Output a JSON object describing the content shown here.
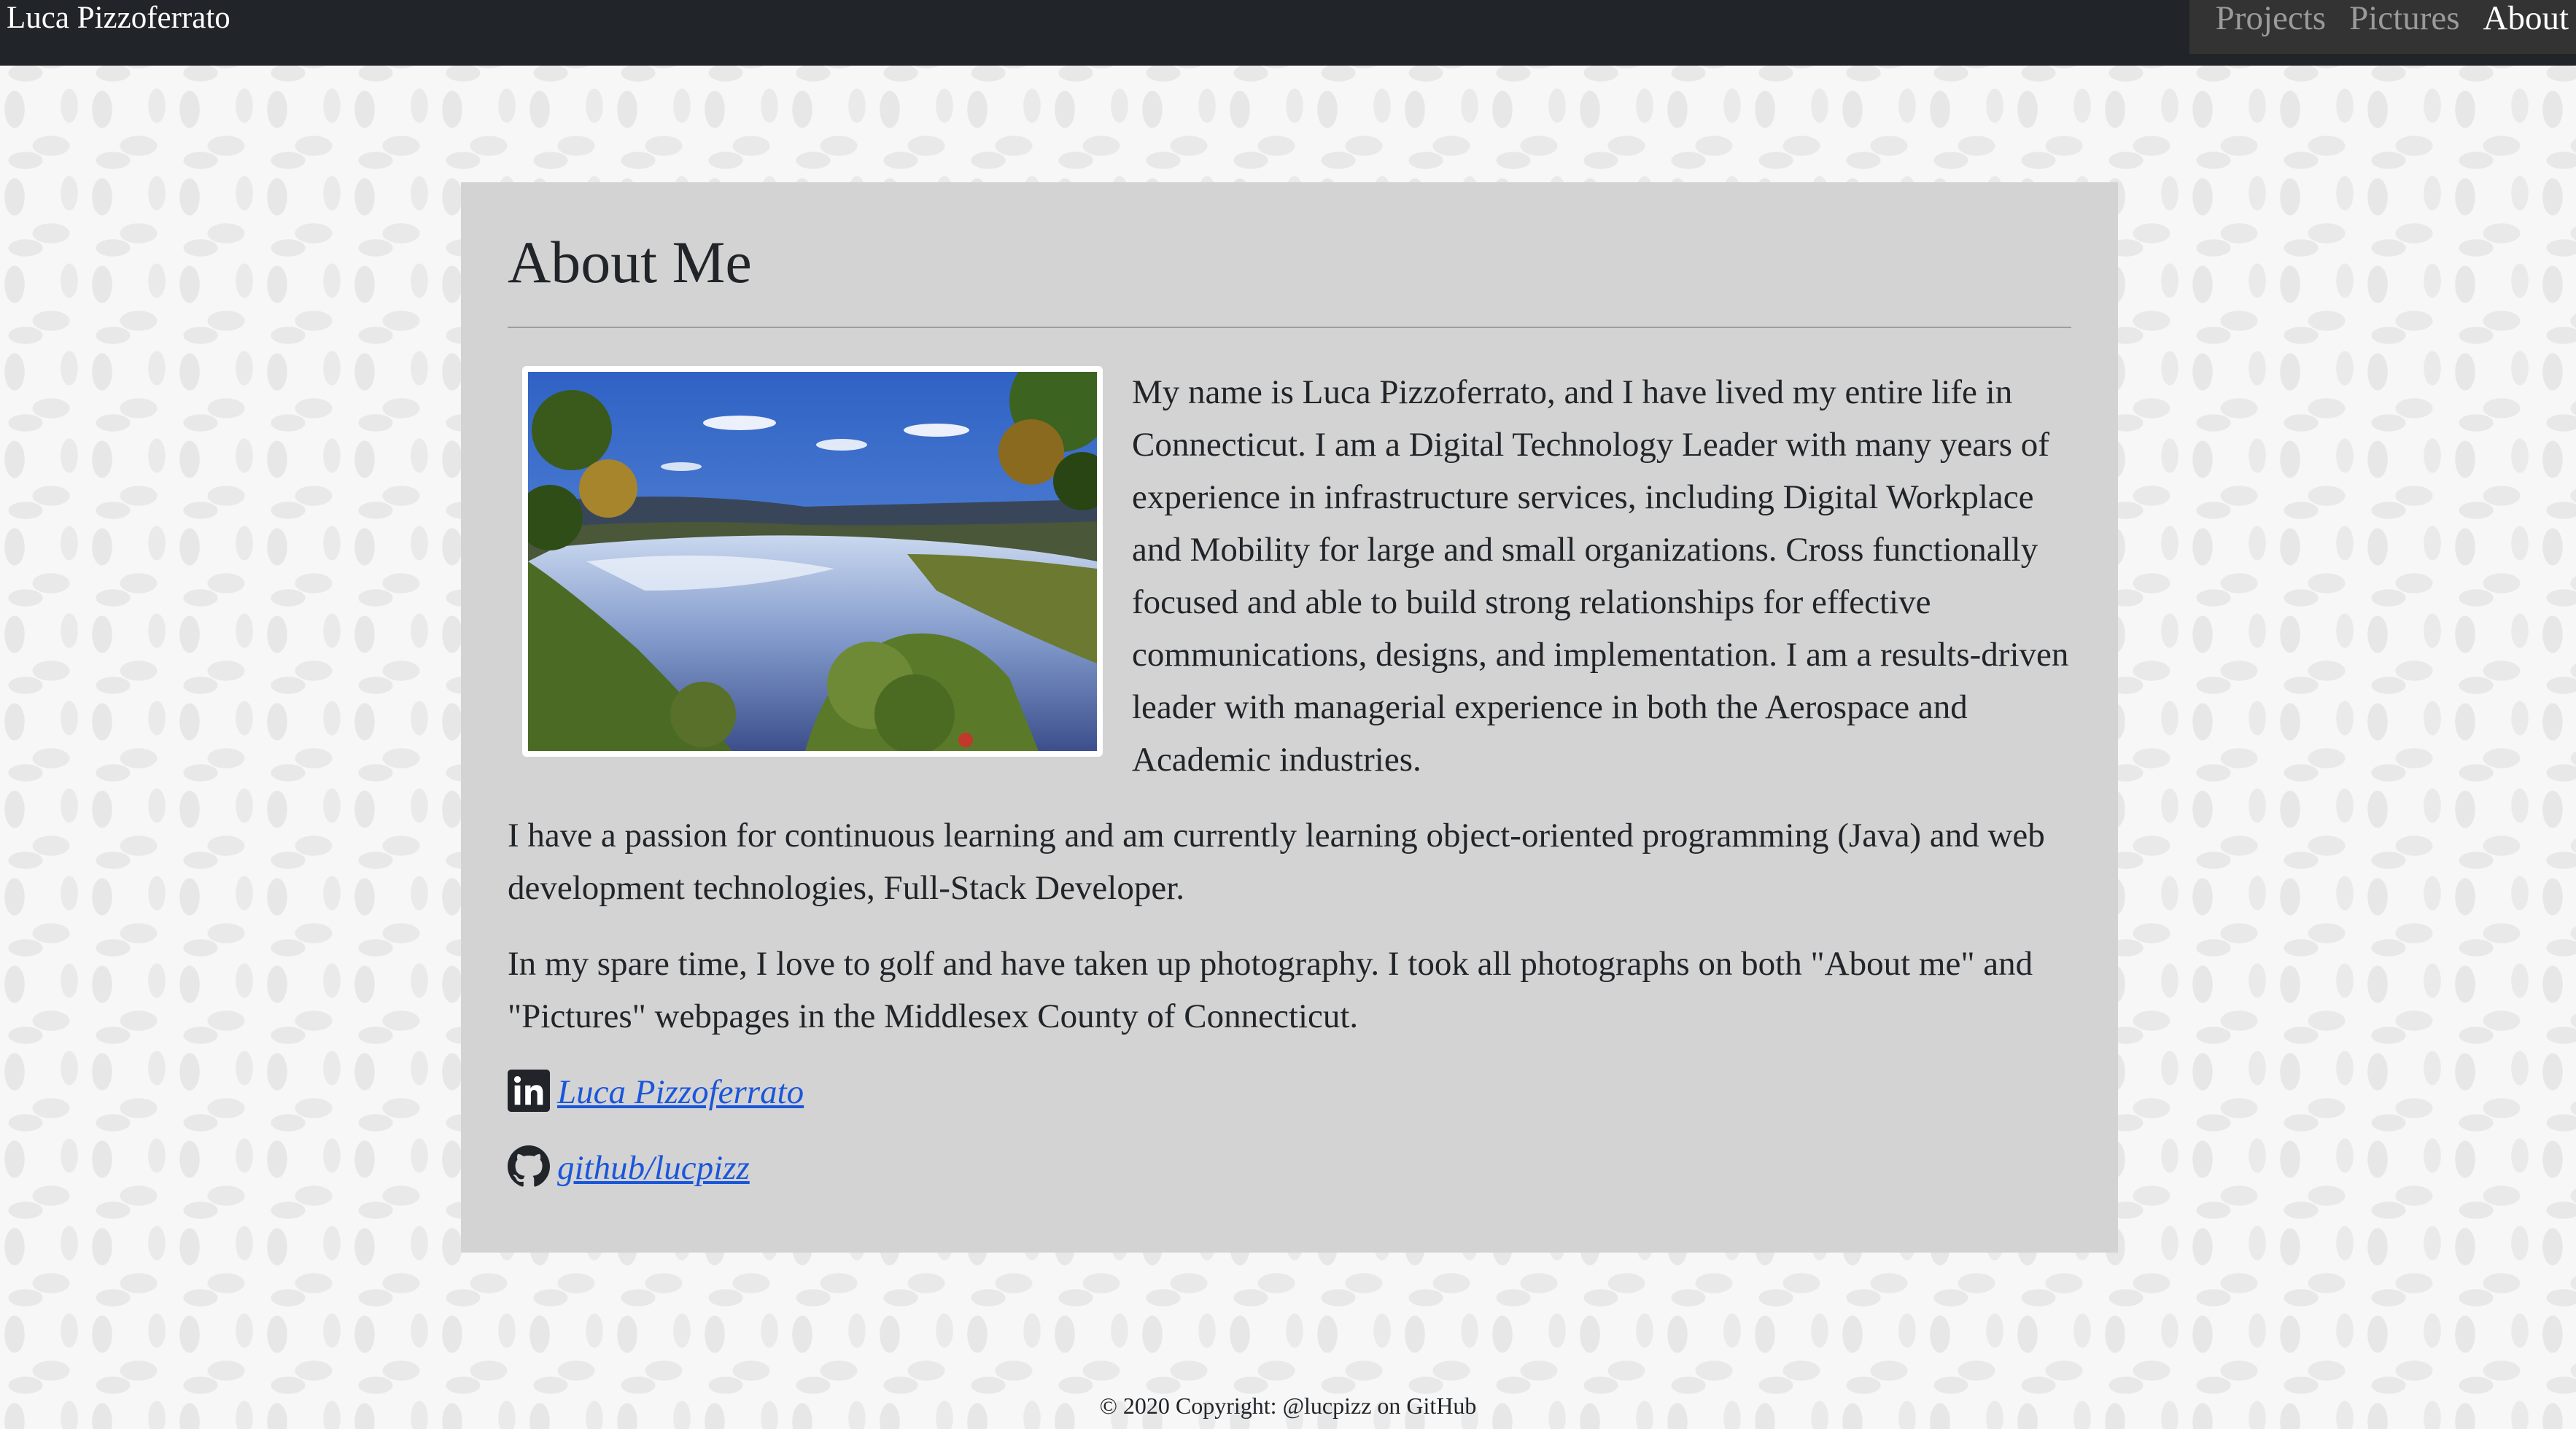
{
  "navbar": {
    "brand": "Luca Pizzoferrato",
    "links": [
      "Projects",
      "Pictures",
      "About"
    ],
    "active": "About"
  },
  "about": {
    "title": "About Me",
    "paragraph1": "My name is Luca Pizzoferrato, and I have lived my entire life in Connecticut. I am a Digital Technology Leader with many years of experience in infrastructure services, including Digital Workplace and Mobility for large and small organizations. Cross functionally focused and able to build strong relationships for effective communications, designs, and implementation. I am a results-driven leader with managerial experience in both the Aerospace and Academic industries.",
    "paragraph2": "I have a passion for continuous learning and am currently learning object-oriented programming (Java) and web development technologies, Full-Stack Developer.",
    "paragraph3": "In my spare time, I love to golf and have taken up photography. I took all photographs on both \"About me\" and \"Pictures\" webpages in the Middlesex County of Connecticut.",
    "linkedin_label": "Luca Pizzoferrato",
    "github_label": "github/lucpizz"
  },
  "icons": {
    "linkedin": "linkedin-icon",
    "github": "github-icon"
  },
  "colors": {
    "navbar": "#212529",
    "card": "#d3d3d3",
    "link": "#1a56db"
  },
  "footer": {
    "text": "© 2020 Copyright: @lucpizz on GitHub"
  }
}
